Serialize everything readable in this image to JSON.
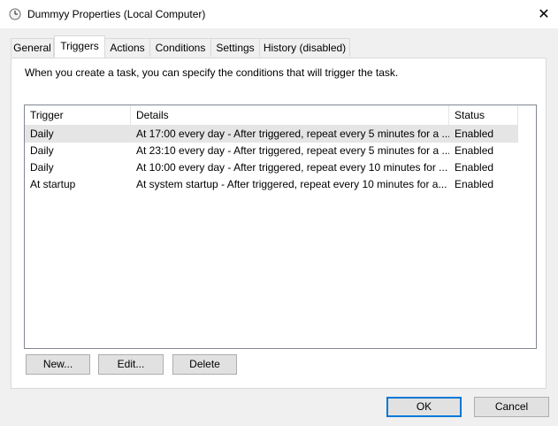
{
  "window": {
    "title": "Dummyy Properties (Local Computer)",
    "icon": "clock-icon"
  },
  "tabs": [
    {
      "label": "General"
    },
    {
      "label": "Triggers",
      "active": true
    },
    {
      "label": "Actions"
    },
    {
      "label": "Conditions"
    },
    {
      "label": "Settings"
    },
    {
      "label": "History (disabled)"
    }
  ],
  "triggers_panel": {
    "description": "When you create a task, you can specify the conditions that will trigger the task.",
    "columns": {
      "trigger": "Trigger",
      "details": "Details",
      "status": "Status"
    },
    "rows": [
      {
        "trigger": "Daily",
        "details": "At 17:00 every day - After triggered, repeat every 5 minutes for a ...",
        "status": "Enabled",
        "selected": true
      },
      {
        "trigger": "Daily",
        "details": "At 23:10 every day - After triggered, repeat every 5 minutes for a ...",
        "status": "Enabled"
      },
      {
        "trigger": "Daily",
        "details": "At 10:00 every day - After triggered, repeat every 10 minutes for ...",
        "status": "Enabled"
      },
      {
        "trigger": "At startup",
        "details": "At system startup - After triggered, repeat every 10 minutes for a...",
        "status": "Enabled"
      }
    ],
    "buttons": {
      "new": "New...",
      "edit": "Edit...",
      "delete": "Delete"
    }
  },
  "footer": {
    "ok": "OK",
    "cancel": "Cancel"
  },
  "colors": {
    "accent": "#0078d7",
    "selected_row": "#e5e5e5",
    "dialog_bg": "#f0f0f0"
  }
}
